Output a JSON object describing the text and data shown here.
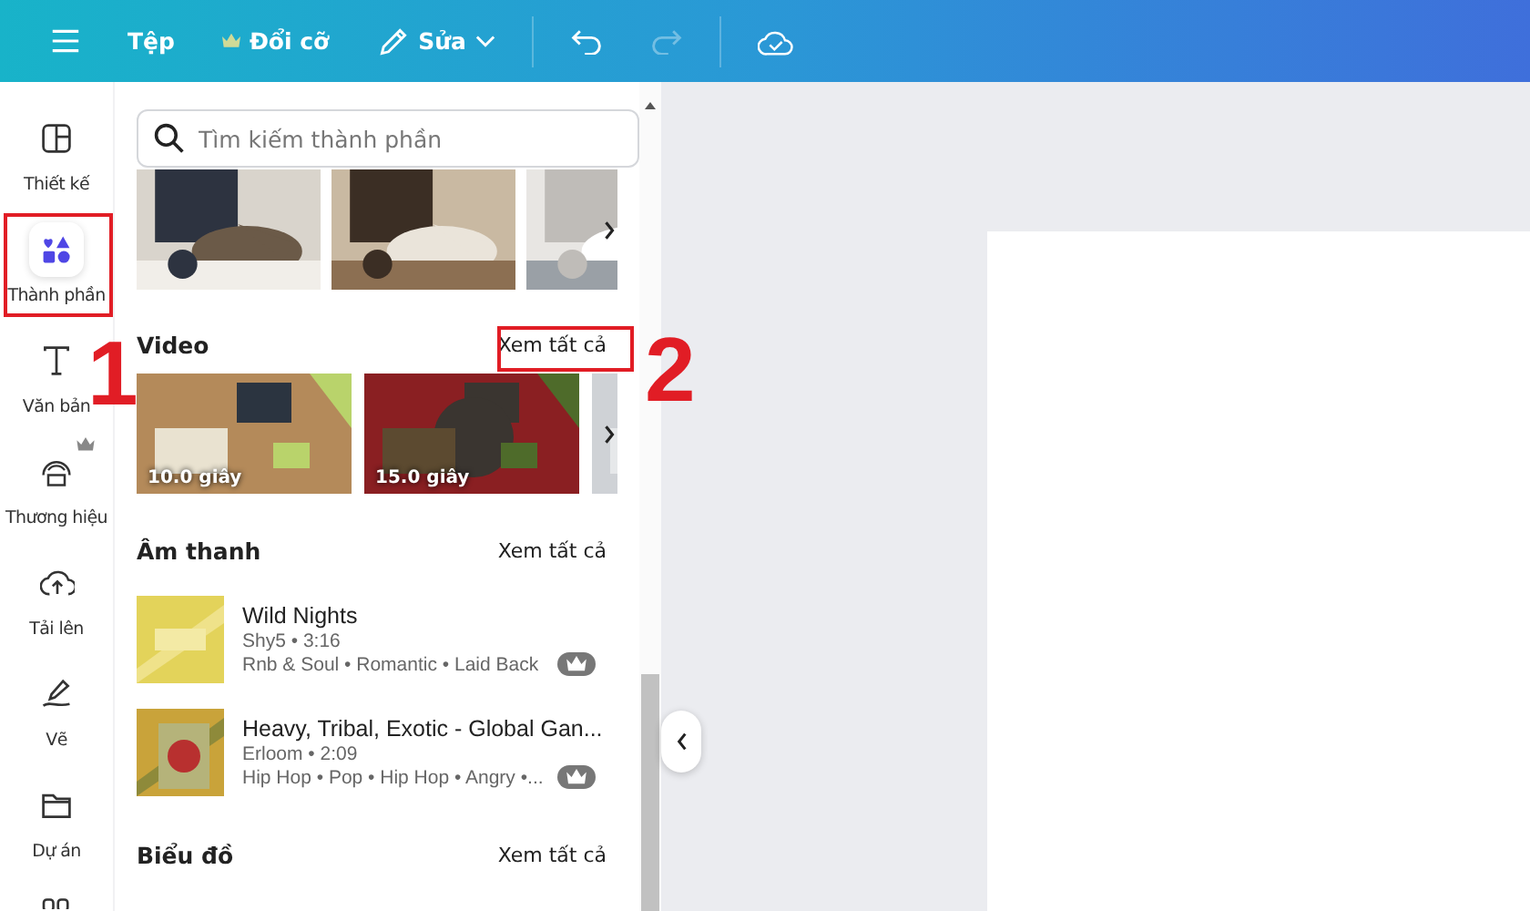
{
  "topbar": {
    "file": "Tệp",
    "resize": "Đổi cỡ",
    "edit": "Sửa",
    "redo_disabled": true
  },
  "rail": [
    {
      "label": "Thiết kế",
      "selected": false,
      "premium": false
    },
    {
      "label": "Thành phần",
      "selected": true,
      "premium": false
    },
    {
      "label": "Văn bản",
      "selected": false,
      "premium": false
    },
    {
      "label": "Thương hiệu",
      "selected": false,
      "premium": true
    },
    {
      "label": "Tải lên",
      "selected": false,
      "premium": false
    },
    {
      "label": "Vẽ",
      "selected": false,
      "premium": false
    },
    {
      "label": "Dự án",
      "selected": false,
      "premium": false
    }
  ],
  "search": {
    "placeholder": "Tìm kiếm thành phần"
  },
  "photos": [
    {
      "kind": "picture"
    },
    {
      "kind": "picture"
    },
    {
      "kind": "picture"
    }
  ],
  "video": {
    "title": "Video",
    "see_all": "Xem tất cả",
    "items": [
      {
        "kind": "video",
        "duration": "10.0 giây"
      },
      {
        "kind": "video",
        "duration": "15.0 giây"
      },
      {
        "kind": "picture"
      }
    ]
  },
  "audio": {
    "title": "Âm thanh",
    "see_all": "Xem tất cả",
    "tracks": [
      {
        "title": "Wild Nights",
        "meta": "Shy5 • 3:16",
        "tags": "Rnb & Soul • Romantic • Laid Back",
        "premium": true
      },
      {
        "title": "Heavy, Tribal, Exotic - Global Gan...",
        "meta": "Erloom • 2:09",
        "tags": "Hip Hop • Pop • Hip Hop • Angry •...",
        "premium": true
      }
    ]
  },
  "charts": {
    "title": "Biểu đồ",
    "see_all": "Xem tất cả"
  },
  "annotations": [
    {
      "label": "1"
    },
    {
      "label": "2"
    }
  ]
}
